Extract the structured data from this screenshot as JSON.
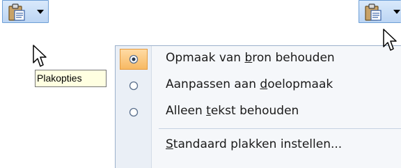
{
  "tooltip": {
    "text": "Plakopties"
  },
  "menu": {
    "items": [
      {
        "pre": "Opmaak van ",
        "accel": "b",
        "post": "ron behouden",
        "selected": true
      },
      {
        "pre": "Aanpassen aan ",
        "accel": "d",
        "post": "oelopmaak",
        "selected": false
      },
      {
        "pre": "Alleen ",
        "accel": "t",
        "post": "ekst behouden",
        "selected": false
      }
    ],
    "command": {
      "pre": "",
      "accel": "S",
      "post": "tandaard plakken instellen..."
    }
  },
  "icons": {
    "paste_button": "clipboard-paste-icon",
    "dropdown": "chevron-down-icon",
    "cursor": "mouse-pointer-icon",
    "radio_selected": "radio-selected-icon",
    "radio_unselected": "radio-unselected-icon"
  },
  "colors": {
    "button_border": "#6e9fd6",
    "button_fill": "#bcd5f3",
    "tooltip_bg": "#ffffe1",
    "selection_fill": "#f7b963",
    "selection_border": "#e49b40",
    "menu_bg": "#f5f7fa"
  }
}
